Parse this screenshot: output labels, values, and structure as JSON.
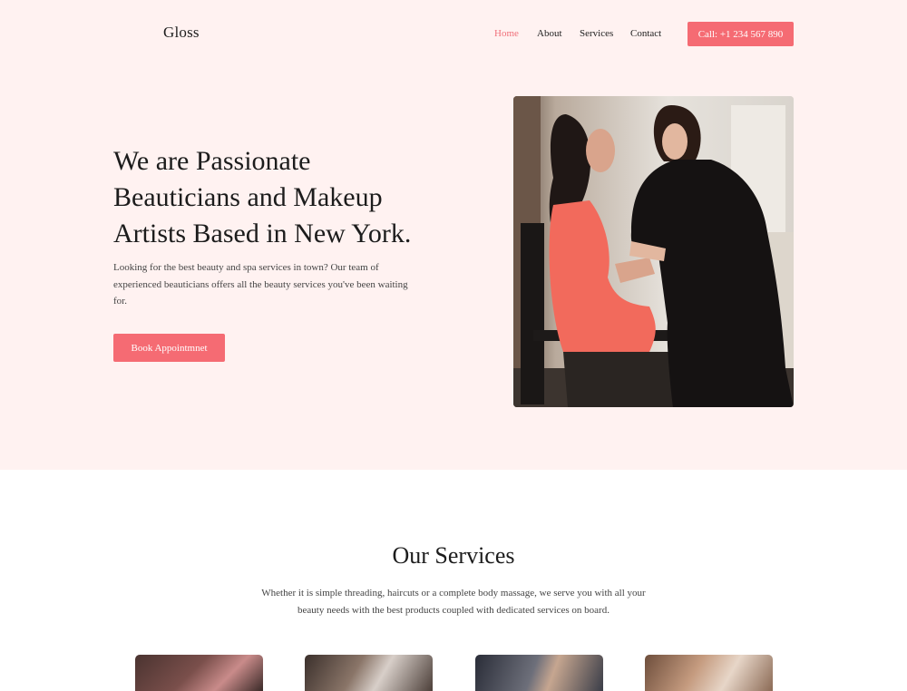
{
  "brand": {
    "name": "Gloss"
  },
  "nav": {
    "items": [
      {
        "label": "Home",
        "active": true
      },
      {
        "label": "About",
        "active": false
      },
      {
        "label": "Services",
        "active": false
      },
      {
        "label": "Contact",
        "active": false
      }
    ],
    "call_label": "Call: +1 234 567 890"
  },
  "hero": {
    "title": "We are Passionate Beauticians and Makeup Artists Based in New York.",
    "text": "Looking for the best beauty and spa services in town? Our team of experienced beauticians offers all the beauty services you've been waiting for.",
    "button_label": "Book Appointmnet"
  },
  "services": {
    "title": "Our Services",
    "text": "Whether it is simple threading, haircuts or a complete body massage, we serve you with all your beauty needs with the best products coupled with dedicated services on board."
  },
  "colors": {
    "accent": "#f56b73",
    "hero_background": "#fff2f1",
    "text": "#1c1c1c"
  }
}
